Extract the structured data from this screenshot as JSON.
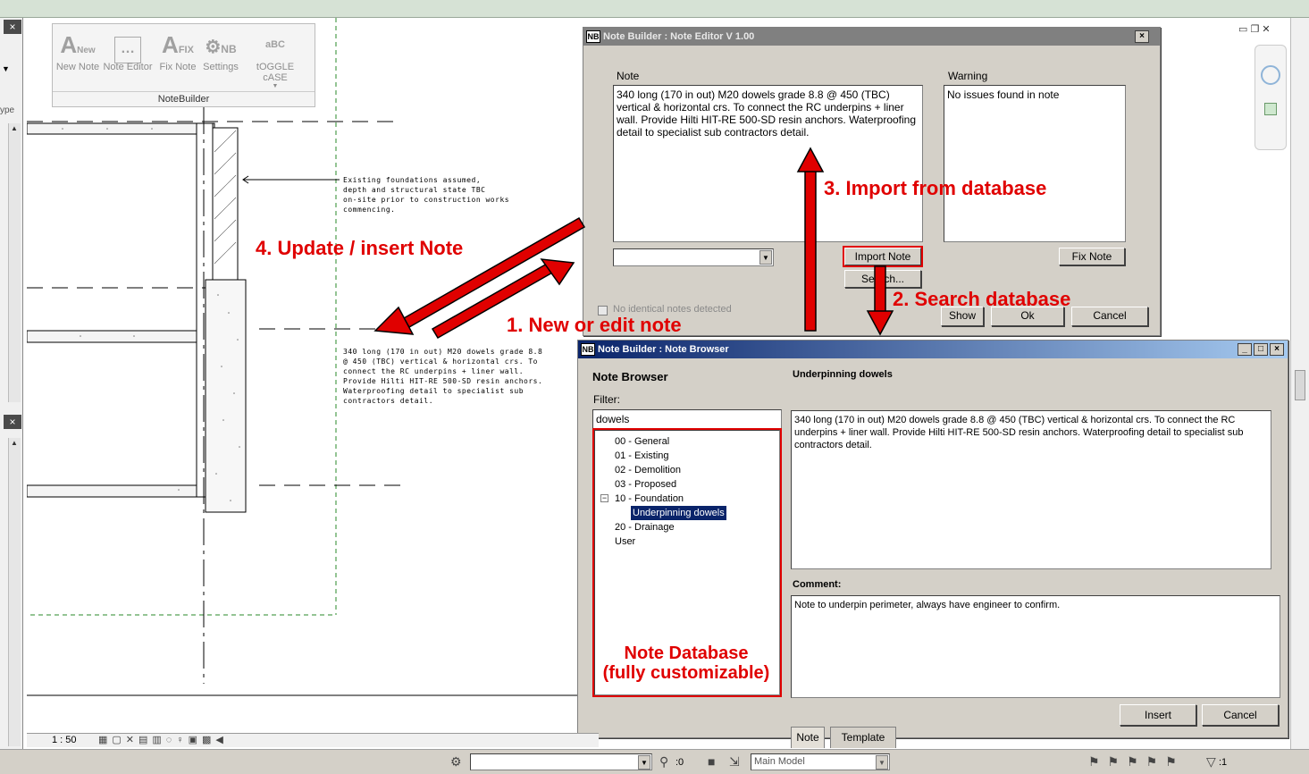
{
  "ribbon": {
    "buttons": [
      {
        "label": "New Note",
        "glyph": "A"
      },
      {
        "label": "Note Editor",
        "glyph": "…"
      },
      {
        "label": "Fix Note",
        "glyph": "A"
      },
      {
        "label": "Settings",
        "glyph": "⚙"
      },
      {
        "label": "tOGGLE cASE",
        "glyph": "aBC"
      }
    ],
    "glyph_sub": {
      "new": "New",
      "fix": "FIX",
      "settings": "NB"
    },
    "panel_title": "NoteBuilder"
  },
  "left_panel": {
    "close_icon": "×",
    "type_label": "ype"
  },
  "drawing": {
    "existing_note": "Existing foundations assumed,\ndepth and structural state TBC\non-site prior to construction works\ncommencing.",
    "placed_note": "340 long (170 in out) M20 dowels grade 8.8\n@ 450 (TBC) vertical & horizontal crs. To\nconnect the RC underpins + liner wall.\nProvide Hilti HIT-RE 500-SD resin anchors.\nWaterproofing detail to specialist sub\ncontractors detail."
  },
  "editor": {
    "badge": "NB",
    "title": "Note Builder : Note Editor V 1.00",
    "note_label": "Note",
    "note_text": "340 long (170 in out) M20 dowels grade 8.8 @ 450 (TBC) vertical & horizontal crs. To connect the RC underpins + liner wall. Provide Hilti HIT-RE 500-SD resin anchors. Waterproofing detail to specialist sub contractors detail.",
    "warning_label": "Warning",
    "warning_text": "No issues found in note",
    "combo_value": "",
    "import_button": "Import Note",
    "search_button": "Search...",
    "fix_button": "Fix Note",
    "checkbox_label": "No identical notes detected",
    "show_button": "Show",
    "ok_button": "Ok",
    "cancel_button": "Cancel",
    "close_glyph": "×"
  },
  "browser": {
    "badge": "NB",
    "title": "Note Builder : Note Browser",
    "heading": "Note Browser",
    "filter_label": "Filter:",
    "filter_value": "dowels",
    "tree": [
      {
        "label": "00 - General"
      },
      {
        "label": "01 - Existing"
      },
      {
        "label": "02 - Demolition"
      },
      {
        "label": "03 - Proposed"
      },
      {
        "label": "10 - Foundation",
        "expanded": true
      },
      {
        "label": "Underpinning dowels",
        "selected": true
      },
      {
        "label": "20 - Drainage"
      },
      {
        "label": "User"
      }
    ],
    "note_title": "Underpinning dowels",
    "tabs": [
      "Note",
      "Template"
    ],
    "active_tab": "Note",
    "note_text": "340 long (170 in out) M20 dowels grade 8.8 @ 450 (TBC) vertical & horizontal crs. To connect the RC underpins + liner wall. Provide Hilti HIT-RE 500-SD resin anchors. Waterproofing detail to specialist sub contractors detail.",
    "comment_label": "Comment:",
    "comment_text": "Note to underpin perimeter, always have engineer to confirm.",
    "insert_button": "Insert",
    "cancel_button": "Cancel",
    "win_buttons": [
      "_",
      "□",
      "×"
    ]
  },
  "annotations": {
    "step1": "1. New or edit note",
    "step2": "2. Search database",
    "step3": "3. Import from database",
    "step4": "4. Update / insert Note",
    "db_line1": "Note Database",
    "db_line2": "(fully customizable)"
  },
  "view_bar": {
    "scale": "1 : 50"
  },
  "status_bar": {
    "zero": ":0",
    "model": "Main Model",
    "filter_count": ":1"
  },
  "colors": {
    "annotation": "#e00000",
    "dialog_bg": "#d4d0c8",
    "selection": "#0a246a",
    "topbar": "#d6e2d5"
  }
}
